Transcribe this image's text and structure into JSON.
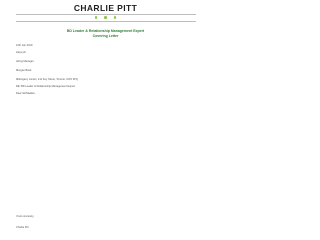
{
  "header": {
    "name": "CHARLIE PITT",
    "contact": [
      "",
      "",
      ""
    ]
  },
  "titles": {
    "job_title": "BD Leader & Relationship Management Expert",
    "letter_title": "Covering Letter"
  },
  "letter": {
    "date": "10th Jan 2019",
    "to": "Hays plc",
    "recipient_role": "Hiring Manager",
    "company": "Morgan Bank",
    "address": "Mahogany Center, 211 Key Street, Toronto, KW1 3PQ",
    "subject": "RE: BD Leader & Relationship Management Expert",
    "greeting": "Dear Sir/Madam,",
    "paragraphs": [
      "",
      "",
      "",
      ""
    ],
    "closing": "Yours sincerely,",
    "signature": "Charlie Pitt"
  },
  "colors": {
    "accent_green": "#8dc63f",
    "heading_green": "#2e7d32"
  }
}
